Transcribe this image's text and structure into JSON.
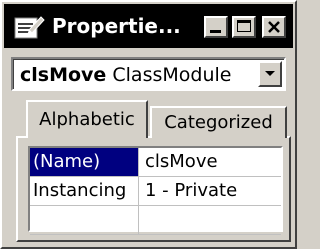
{
  "window": {
    "title": "Propertie...",
    "icon": "properties-window-icon",
    "buttons": {
      "minimize": "minimize-icon",
      "maximize": "maximize-icon",
      "close": "close-icon"
    }
  },
  "object_combo": {
    "object_name": "clsMove",
    "object_type": "ClassModule",
    "dropdown_icon": "chevron-down-icon"
  },
  "tabs": [
    {
      "label": "Alphabetic",
      "selected": true
    },
    {
      "label": "Categorized",
      "selected": false
    }
  ],
  "properties": [
    {
      "name": "(Name)",
      "value": "clsMove",
      "selected": true
    },
    {
      "name": "Instancing",
      "value": "1 - Private",
      "selected": false
    },
    {
      "name": "",
      "value": ""
    }
  ],
  "colors": {
    "titlebar": "#000000",
    "title_text": "#ffffff",
    "face": "#d4d0c8",
    "selection": "#000080"
  }
}
